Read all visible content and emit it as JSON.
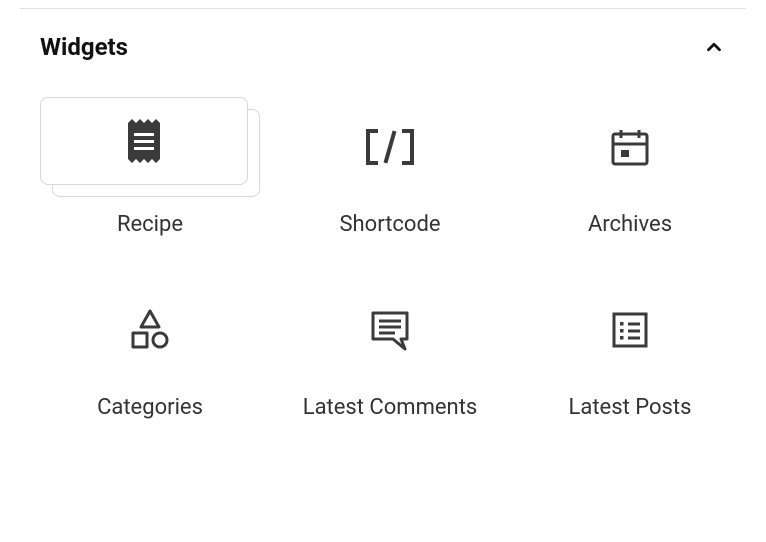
{
  "panel": {
    "title": "Widgets",
    "expanded": true
  },
  "widgets": [
    {
      "id": "recipe",
      "label": "Recipe",
      "icon": "recipe-icon",
      "selected": true
    },
    {
      "id": "shortcode",
      "label": "Shortcode",
      "icon": "shortcode-icon",
      "selected": false
    },
    {
      "id": "archives",
      "label": "Archives",
      "icon": "archives-icon",
      "selected": false
    },
    {
      "id": "categories",
      "label": "Categories",
      "icon": "categories-icon",
      "selected": false
    },
    {
      "id": "latest-comments",
      "label": "Latest Comments",
      "icon": "comments-icon",
      "selected": false
    },
    {
      "id": "latest-posts",
      "label": "Latest Posts",
      "icon": "posts-icon",
      "selected": false
    }
  ]
}
